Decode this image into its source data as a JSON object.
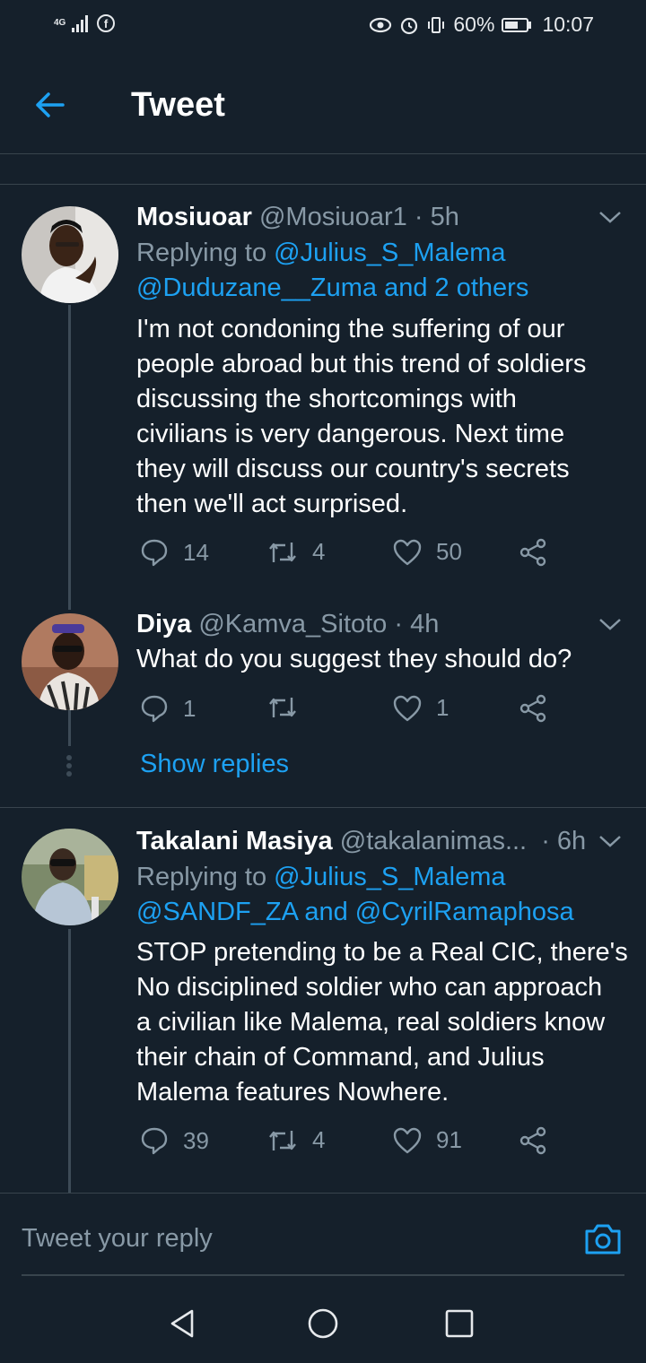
{
  "status_bar": {
    "network": "4G",
    "battery": "60%",
    "battery_level": 0.6,
    "time": "10:07"
  },
  "header": {
    "title": "Tweet",
    "back_icon": "arrow-left-icon"
  },
  "tweets": [
    {
      "name": "Mosiuoar",
      "handle": "@Mosiuoar1",
      "time": "· 5h",
      "replying_prefix": "Replying to",
      "replying_line1": "@Julius_S_Malema",
      "replying_line2": "@Duduzane__Zuma and 2 others",
      "body_lines": [
        "I'm not condoning the suffering of our",
        "people abroad but this trend of soldiers",
        "discussing the shortcomings with",
        "civilians is very dangerous. Next time",
        "they will discuss our country's secrets",
        "then we'll act surprised."
      ],
      "replies": "14",
      "retweets": "4",
      "likes": "50"
    },
    {
      "name": "Diya",
      "handle": "@Kamva_Sitoto",
      "time": "· 4h",
      "body_lines": [
        "What do you suggest they should do?"
      ],
      "replies": "1",
      "retweets": "",
      "likes": "1"
    },
    {
      "name": "Takalani Masiya",
      "handle": "@takalanimas...",
      "time": "· 6h",
      "replying_prefix": "Replying to",
      "replying_line1": "@Julius_S_Malema",
      "replying_line2": "@SANDF_ZA and @CyrilRamaphosa",
      "body_lines": [
        "STOP pretending to be a Real CIC, there's",
        "No disciplined soldier who can approach",
        "a civilian like Malema, real soldiers know",
        "their chain of Command, and Julius",
        "Malema features Nowhere."
      ],
      "replies": "39",
      "retweets": "4",
      "likes": "91"
    }
  ],
  "show_replies": "Show replies",
  "reply_bar": {
    "placeholder": "Tweet your reply",
    "camera_icon": "camera-icon"
  },
  "colors": {
    "background": "#15202b",
    "accent": "#1da1f2",
    "muted": "#8899a6",
    "divider": "#38444d"
  }
}
